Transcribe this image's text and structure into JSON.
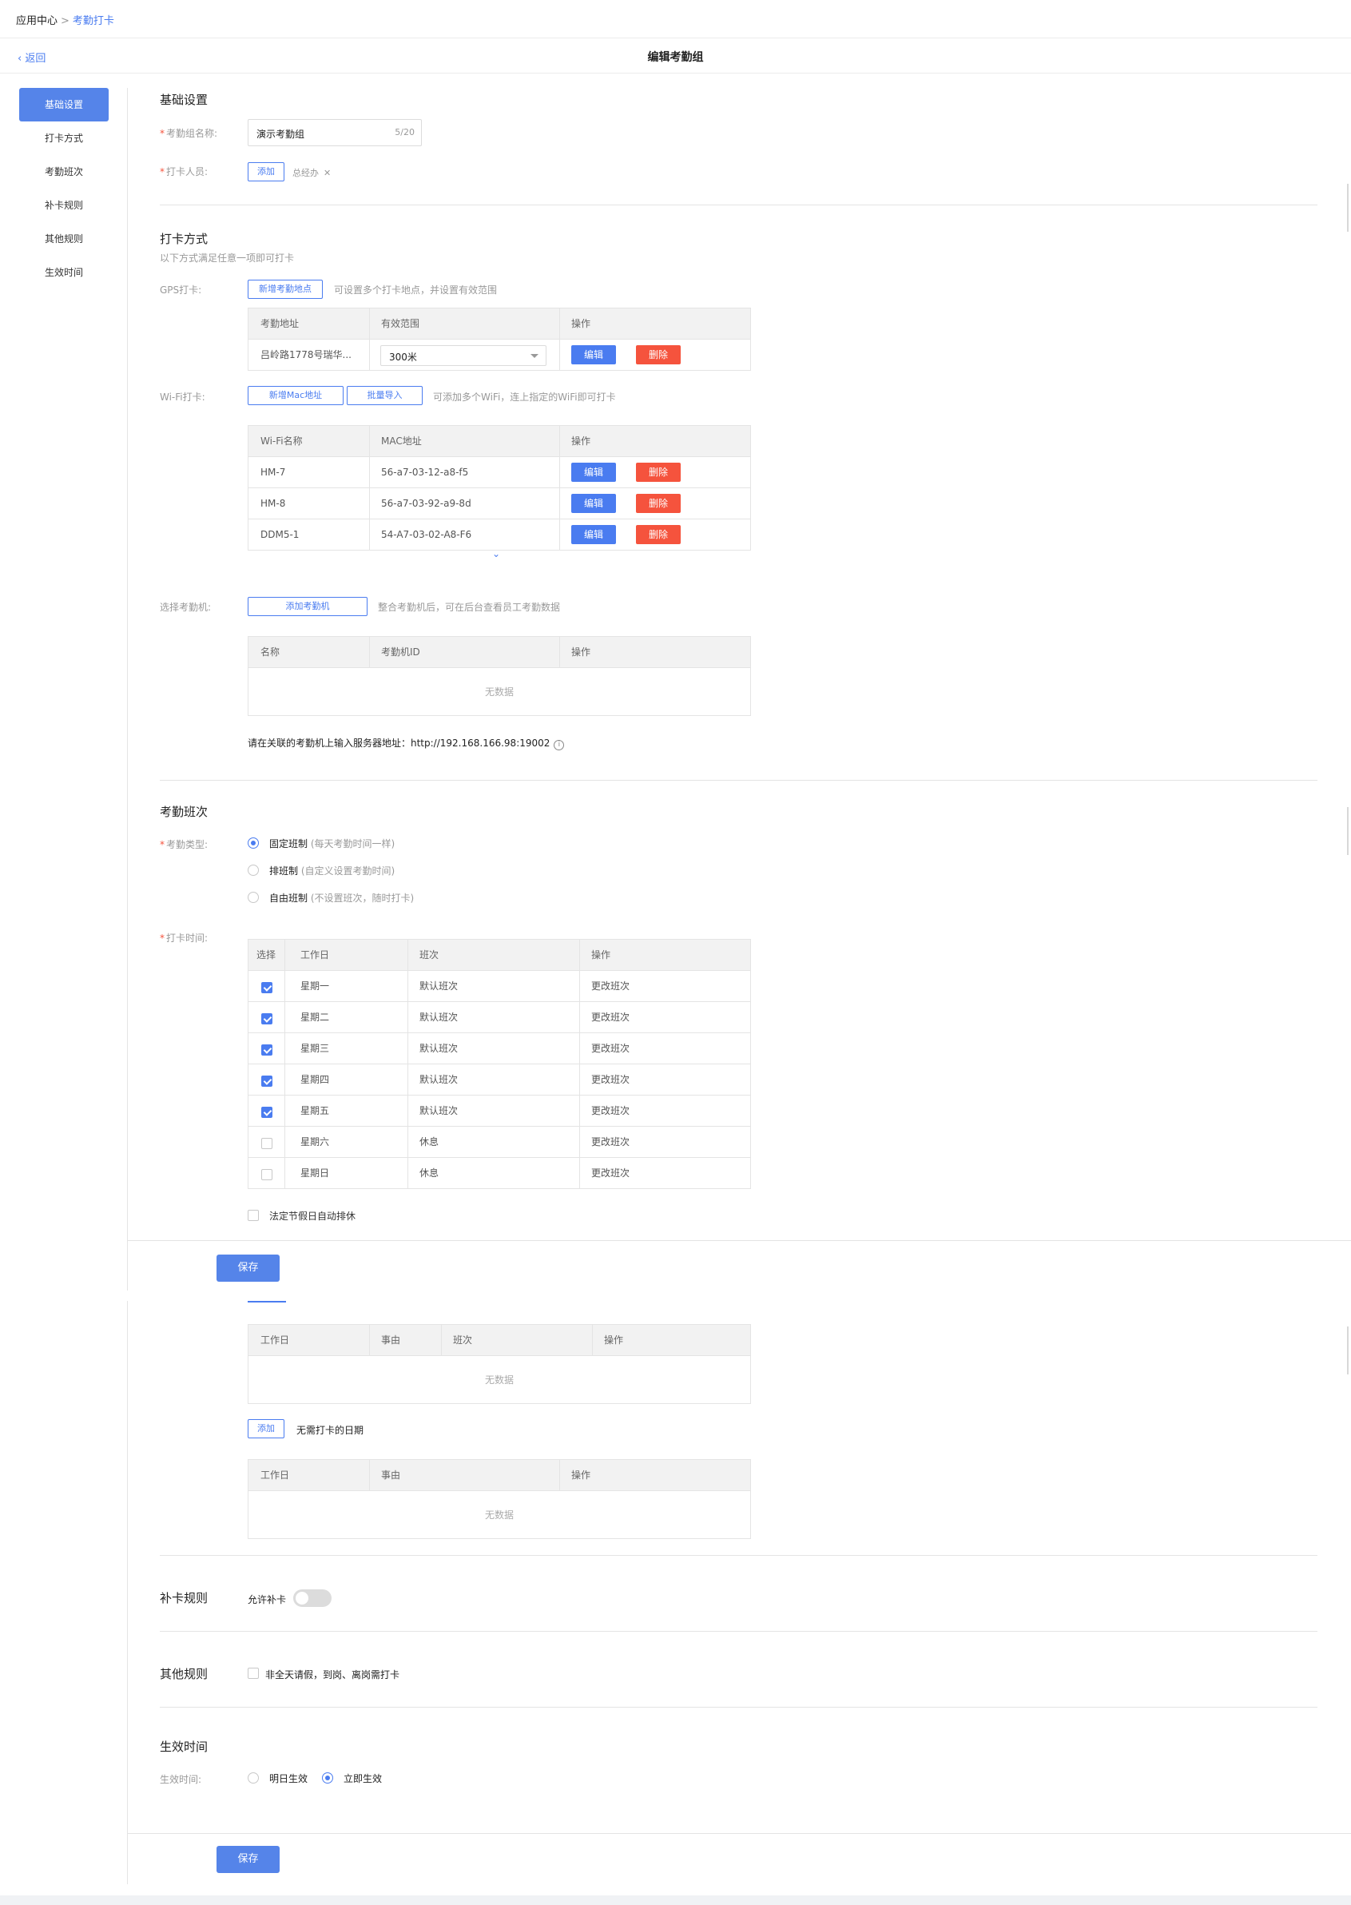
{
  "breadcrumb": {
    "root": "应用中心",
    "current": "考勤打卡"
  },
  "header": {
    "back": "返回",
    "title": "编辑考勤组"
  },
  "sidebar": {
    "items": [
      "基础设置",
      "打卡方式",
      "考勤班次",
      "补卡规则",
      "其他规则",
      "生效时间"
    ]
  },
  "basic": {
    "title": "基础设置",
    "name_label": "考勤组名称:",
    "name_value": "演示考勤组",
    "name_count": "5/20",
    "members_label": "打卡人员:",
    "add_label": "添加",
    "member_tag": "总经办"
  },
  "punch": {
    "title": "打卡方式",
    "desc": "以下方式满足任意一项即可打卡",
    "gps_label": "GPS打卡:",
    "gps_add": "新增考勤地点",
    "gps_hint": "可设置多个打卡地点，并设置有效范围",
    "gps_cols": [
      "考勤地址",
      "有效范围",
      "操作"
    ],
    "gps_row": {
      "address": "吕岭路1778号瑞华...",
      "range": "300米"
    },
    "edit_label": "编辑",
    "delete_label": "删除",
    "wifi_label": "Wi-Fi打卡:",
    "wifi_add": "新增Mac地址",
    "wifi_import": "批量导入",
    "wifi_hint": "可添加多个WiFi，连上指定的WiFi即可打卡",
    "wifi_cols": [
      "Wi-Fi名称",
      "MAC地址",
      "操作"
    ],
    "wifi_rows": [
      {
        "name": "HM-7",
        "mac": "56-a7-03-12-a8-f5"
      },
      {
        "name": "HM-8",
        "mac": "56-a7-03-92-a9-8d"
      },
      {
        "name": "DDM5-1",
        "mac": "54-A7-03-02-A8-F6"
      }
    ],
    "machine_label": "选择考勤机:",
    "machine_add": "添加考勤机",
    "machine_hint": "整合考勤机后，可在后台查看员工考勤数据",
    "machine_cols": [
      "名称",
      "考勤机ID",
      "操作"
    ],
    "no_data": "无数据",
    "server_note": "请在关联的考勤机上输入服务器地址：http://192.168.166.98:19002"
  },
  "shift": {
    "title": "考勤班次",
    "type_label": "考勤类型:",
    "options": [
      {
        "main": "固定班制",
        "sub": "(每天考勤时间一样)"
      },
      {
        "main": "排班制",
        "sub": "(自定义设置考勤时间)"
      },
      {
        "main": "自由班制",
        "sub": "(不设置班次，随时打卡)"
      }
    ],
    "time_label": "打卡时间:",
    "cols": [
      "选择",
      "工作日",
      "班次",
      "操作"
    ],
    "rows": [
      {
        "day": "星期一",
        "shift": "默认班次",
        "checked": true
      },
      {
        "day": "星期二",
        "shift": "默认班次",
        "checked": true
      },
      {
        "day": "星期三",
        "shift": "默认班次",
        "checked": true
      },
      {
        "day": "星期四",
        "shift": "默认班次",
        "checked": true
      },
      {
        "day": "星期五",
        "shift": "默认班次",
        "checked": true
      },
      {
        "day": "星期六",
        "shift": "休息",
        "checked": false
      },
      {
        "day": "星期日",
        "shift": "休息",
        "checked": false
      }
    ],
    "action": "更改班次",
    "holiday": "法定节假日自动排休",
    "special_cols": [
      "工作日",
      "事由",
      "班次",
      "操作"
    ],
    "no_punch_add": "添加",
    "no_punch_label": "无需打卡的日期",
    "no_punch_cols": [
      "工作日",
      "事由",
      "操作"
    ]
  },
  "save_label": "保存",
  "makeup": {
    "title": "补卡规则",
    "allow": "允许补卡"
  },
  "other": {
    "title": "其他规则",
    "option": "非全天请假，到岗、离岗需打卡"
  },
  "effective": {
    "title": "生效时间",
    "label": "生效时间:",
    "tomorrow": "明日生效",
    "now": "立即生效"
  },
  "colors": {
    "accent": "#4a7cf0",
    "danger": "#f5533d"
  }
}
